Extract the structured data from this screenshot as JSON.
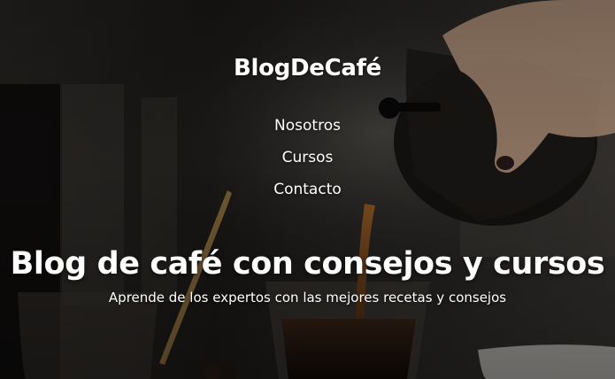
{
  "site": {
    "logo": "BlogDeCafé"
  },
  "nav": {
    "items": [
      {
        "label": "Nosotros"
      },
      {
        "label": "Cursos"
      },
      {
        "label": "Contacto"
      }
    ]
  },
  "hero": {
    "title": "Blog de café con consejos y cursos",
    "subtitle": "Aprende de los expertos con las mejores recetas y consejos"
  }
}
